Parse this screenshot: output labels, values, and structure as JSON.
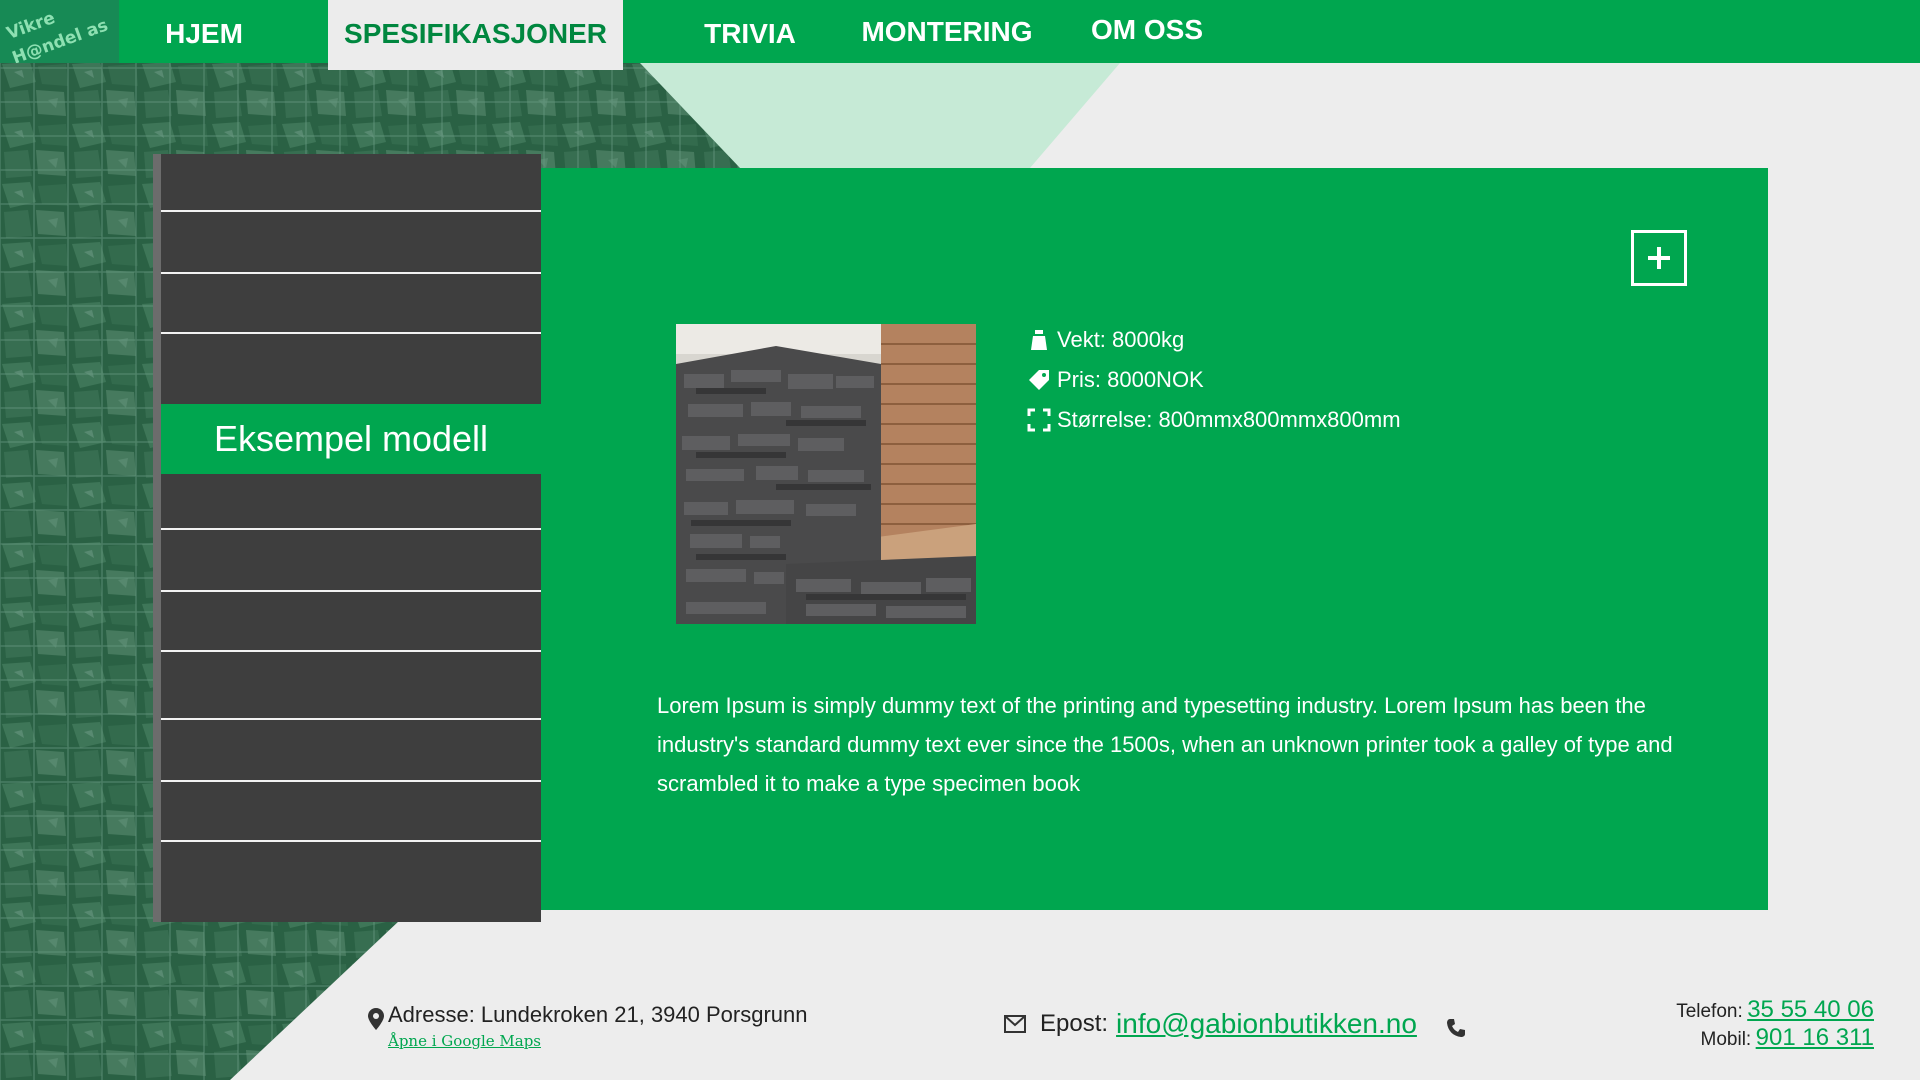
{
  "logo": {
    "line1": "Vikre",
    "line2": "H@ndel as"
  },
  "nav": {
    "items": [
      {
        "label": "HJEM",
        "active": false
      },
      {
        "label": "SPESIFIKASJONER",
        "active": true
      },
      {
        "label": "TRIVIA",
        "active": false
      },
      {
        "label": "MONTERING",
        "active": false
      },
      {
        "label": "OM OSS",
        "active": false
      }
    ]
  },
  "sidebar": {
    "items": [
      {
        "label": ""
      },
      {
        "label": ""
      },
      {
        "label": ""
      },
      {
        "label": ""
      },
      {
        "label": "Eksempel modell",
        "active": true
      },
      {
        "label": ""
      },
      {
        "label": ""
      },
      {
        "label": ""
      },
      {
        "label": ""
      },
      {
        "label": ""
      },
      {
        "label": ""
      },
      {
        "label": ""
      }
    ]
  },
  "product": {
    "weight": "Vekt: 8000kg",
    "price": "Pris: 8000NOK",
    "size": "Størrelse: 800mmx800mmx800mm",
    "description": "Lorem Ipsum is simply dummy text of the printing and typesetting industry. Lorem Ipsum has been the industry's standard dummy text ever since the 1500s, when an unknown printer took a galley of type and scrambled it to make a type specimen book"
  },
  "footer": {
    "address": "Adresse: Lundekroken 21, 3940 Porsgrunn",
    "maps_link": "Åpne  i Google Maps",
    "email_label": "Epost:",
    "email": "info@gabionbutikken.no",
    "phone_label": "Telefon:",
    "phone": "35 55 40 06",
    "mobile_label": "Mobil:",
    "mobile": "901 16 311"
  },
  "colors": {
    "brand_green": "#00a64f",
    "sidebar_dark": "#3e3e3e",
    "page_bg": "#ededed"
  },
  "icons": [
    "weight-icon",
    "price-tag-icon",
    "size-expand-icon",
    "plus-icon",
    "location-pin-icon",
    "mail-icon",
    "phone-icon"
  ]
}
